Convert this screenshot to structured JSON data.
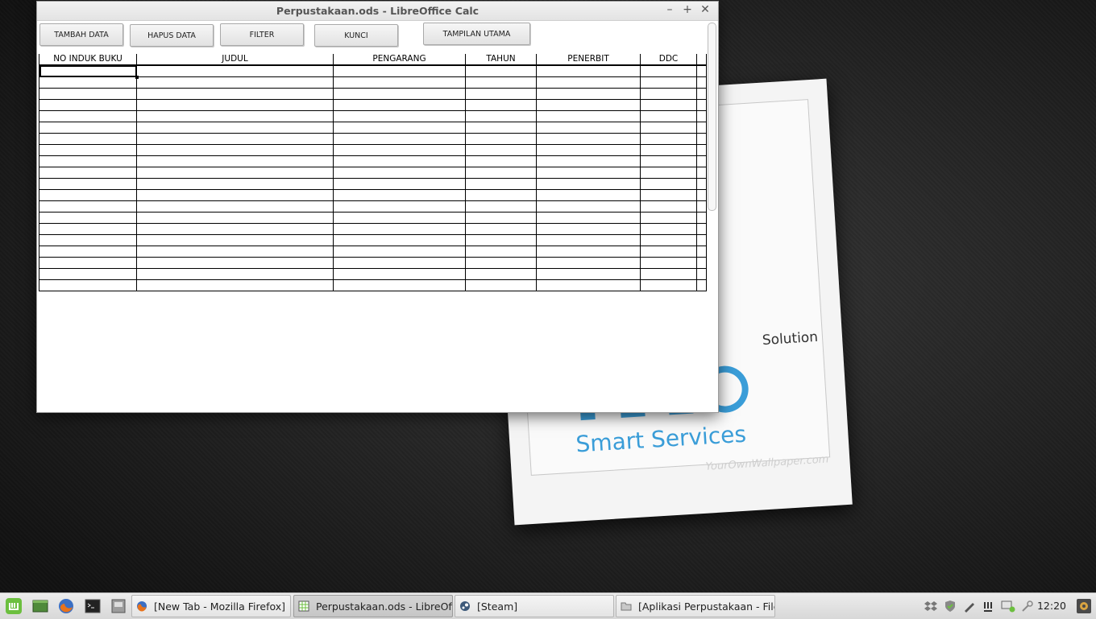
{
  "window": {
    "title": "Perpustakaan.ods - LibreOffice Calc",
    "minimize_glyph": "–",
    "maximize_glyph": "+",
    "close_glyph": "✕"
  },
  "toolbar": {
    "tambah_label": "TAMBAH DATA",
    "hapus_label": "HAPUS DATA",
    "filter_label": "FILTER",
    "kunci_label": "KUNCI",
    "tampilan_label": "TAMPILAN UTAMA"
  },
  "table": {
    "headers": [
      "NO INDUK BUKU",
      "JUDUL",
      "PENGARANG",
      "TAHUN",
      "PENERBIT",
      "DDC",
      ""
    ],
    "row_count": 20,
    "selected_cell": "A1"
  },
  "wallpaper": {
    "tagline": "Solution",
    "brand": "Smart Services",
    "watermark": "YourOwnWallpaper.com"
  },
  "taskbar": {
    "tasks": [
      {
        "label": "[New Tab - Mozilla Firefox]",
        "icon": "firefox-icon"
      },
      {
        "label": "Perpustakaan.ods - LibreOffi...",
        "icon": "calc-icon"
      },
      {
        "label": "[Steam]",
        "icon": "steam-icon"
      },
      {
        "label": "[Aplikasi Perpustakaan - File ...",
        "icon": "folder-icon"
      }
    ],
    "clock": "12:20"
  },
  "colors": {
    "accent_blue": "#3a9dd8",
    "mint_green": "#6cbf3f"
  }
}
